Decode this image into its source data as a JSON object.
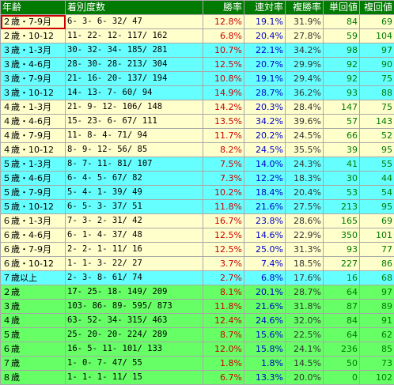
{
  "header": {
    "age": "年齢",
    "record": "着別度数",
    "win_rate": "勝率",
    "top2_rate": "連対率",
    "top3_rate": "複勝率",
    "win_return": "単回値",
    "place_return": "複回値"
  },
  "rows": [
    {
      "age": "２歳・7-9月",
      "record": "6-    3-    6-   32/  47",
      "win_rate": "12.8%",
      "top2_rate": "19.1%",
      "top3_rate": "31.9%",
      "win_return": "84",
      "place_return": "69"
    },
    {
      "age": "２歳・10-12",
      "record": "11-   22-   12- 117/ 162",
      "win_rate": "6.8%",
      "top2_rate": "20.4%",
      "top3_rate": "27.8%",
      "win_return": "59",
      "place_return": "104"
    },
    {
      "age": "３歳・1-3月",
      "record": "30-   32-   34- 185/ 281",
      "win_rate": "10.7%",
      "top2_rate": "22.1%",
      "top3_rate": "34.2%",
      "win_return": "98",
      "place_return": "97"
    },
    {
      "age": "３歳・4-6月",
      "record": "28-   30-   28- 213/ 304",
      "win_rate": "12.5%",
      "top2_rate": "20.7%",
      "top3_rate": "29.9%",
      "win_return": "92",
      "place_return": "90"
    },
    {
      "age": "３歳・7-9月",
      "record": "21-   16-   20- 137/ 194",
      "win_rate": "10.8%",
      "top2_rate": "19.1%",
      "top3_rate": "29.4%",
      "win_return": "92",
      "place_return": "75"
    },
    {
      "age": "３歳・10-12",
      "record": "14-   13-    7-  60/  94",
      "win_rate": "14.9%",
      "top2_rate": "28.7%",
      "top3_rate": "36.2%",
      "win_return": "93",
      "place_return": "88"
    },
    {
      "age": "４歳・1-3月",
      "record": "21-    9-   12- 106/ 148",
      "win_rate": "14.2%",
      "top2_rate": "20.3%",
      "top3_rate": "28.4%",
      "win_return": "147",
      "place_return": "75"
    },
    {
      "age": "４歳・4-6月",
      "record": "15-   23-    6-  67/ 111",
      "win_rate": "13.5%",
      "top2_rate": "34.2%",
      "top3_rate": "39.6%",
      "win_return": "57",
      "place_return": "143"
    },
    {
      "age": "４歳・7-9月",
      "record": "11-    8-    4-  71/  94",
      "win_rate": "11.7%",
      "top2_rate": "20.2%",
      "top3_rate": "24.5%",
      "win_return": "66",
      "place_return": "52"
    },
    {
      "age": "４歳・10-12",
      "record": "8-    9-   12-  56/  85",
      "win_rate": "8.2%",
      "top2_rate": "24.5%",
      "top3_rate": "35.5%",
      "win_return": "39",
      "place_return": "95"
    },
    {
      "age": "５歳・1-3月",
      "record": "8-    7-   11-  81/ 107",
      "win_rate": "7.5%",
      "top2_rate": "14.0%",
      "top3_rate": "24.3%",
      "win_return": "41",
      "place_return": "55"
    },
    {
      "age": "５歳・4-6月",
      "record": "6-    4-    5-  67/  82",
      "win_rate": "7.3%",
      "top2_rate": "12.2%",
      "top3_rate": "18.3%",
      "win_return": "30",
      "place_return": "44"
    },
    {
      "age": "５歳・7-9月",
      "record": "5-    4-    1-  39/  49",
      "win_rate": "10.2%",
      "top2_rate": "18.4%",
      "top3_rate": "20.4%",
      "win_return": "53",
      "place_return": "54"
    },
    {
      "age": "５歳・10-12",
      "record": "6-    5-    3-  37/  51",
      "win_rate": "11.8%",
      "top2_rate": "21.6%",
      "top3_rate": "27.5%",
      "win_return": "213",
      "place_return": "95"
    },
    {
      "age": "６歳・1-3月",
      "record": "7-    3-    2-  31/  42",
      "win_rate": "16.7%",
      "top2_rate": "23.8%",
      "top3_rate": "28.6%",
      "win_return": "165",
      "place_return": "69"
    },
    {
      "age": "６歳・4-6月",
      "record": "6-    1-    4-  37/  48",
      "win_rate": "12.5%",
      "top2_rate": "14.6%",
      "top3_rate": "22.9%",
      "win_return": "350",
      "place_return": "101"
    },
    {
      "age": "６歳・7-9月",
      "record": "2-    2-    1-  11/  16",
      "win_rate": "12.5%",
      "top2_rate": "25.0%",
      "top3_rate": "31.3%",
      "win_return": "93",
      "place_return": "77"
    },
    {
      "age": "６歳・10-12",
      "record": "1-    1-    3-  22/  27",
      "win_rate": "3.7%",
      "top2_rate": "7.4%",
      "top3_rate": "18.5%",
      "win_return": "227",
      "place_return": "86"
    },
    {
      "age": "７歳以上",
      "record": "2-    3-    8-  61/  74",
      "win_rate": "2.7%",
      "top2_rate": "6.8%",
      "top3_rate": "17.6%",
      "win_return": "16",
      "place_return": "68"
    },
    {
      "age": "２歳",
      "record": "17-   25-   18- 149/ 209",
      "win_rate": "8.1%",
      "top2_rate": "20.1%",
      "top3_rate": "28.7%",
      "win_return": "64",
      "place_return": "97"
    },
    {
      "age": "３歳",
      "record": "103-   86-   89- 595/ 873",
      "win_rate": "11.8%",
      "top2_rate": "21.6%",
      "top3_rate": "31.8%",
      "win_return": "87",
      "place_return": "89"
    },
    {
      "age": "４歳",
      "record": "63-   52-   34- 315/ 463",
      "win_rate": "12.4%",
      "top2_rate": "24.6%",
      "top3_rate": "32.0%",
      "win_return": "84",
      "place_return": "91"
    },
    {
      "age": "５歳",
      "record": "25-   20-   20- 224/ 289",
      "win_rate": "8.7%",
      "top2_rate": "15.6%",
      "top3_rate": "22.5%",
      "win_return": "64",
      "place_return": "62"
    },
    {
      "age": "６歳",
      "record": "16-    5-   11- 101/ 133",
      "win_rate": "12.0%",
      "top2_rate": "15.8%",
      "top3_rate": "24.1%",
      "win_return": "236",
      "place_return": "85"
    },
    {
      "age": "７歳",
      "record": "1-    0-    7-  47/  55",
      "win_rate": "1.8%",
      "top2_rate": "1.8%",
      "top3_rate": "14.5%",
      "win_return": "50",
      "place_return": "73"
    },
    {
      "age": "８歳",
      "record": "1-    1-    1-  11/  15",
      "win_rate": "6.7%",
      "top2_rate": "13.3%",
      "top3_rate": "20.0%",
      "win_return": "0",
      "place_return": "102"
    }
  ],
  "colors": {
    "header": "#007a00",
    "cream": "#ffffcc",
    "cyan": "#66ffff",
    "green": "#66ff66",
    "win_text": "#cc0000",
    "top2_text": "#0000cc",
    "return_text": "#007a00",
    "selection_outline": "#cc0000"
  }
}
